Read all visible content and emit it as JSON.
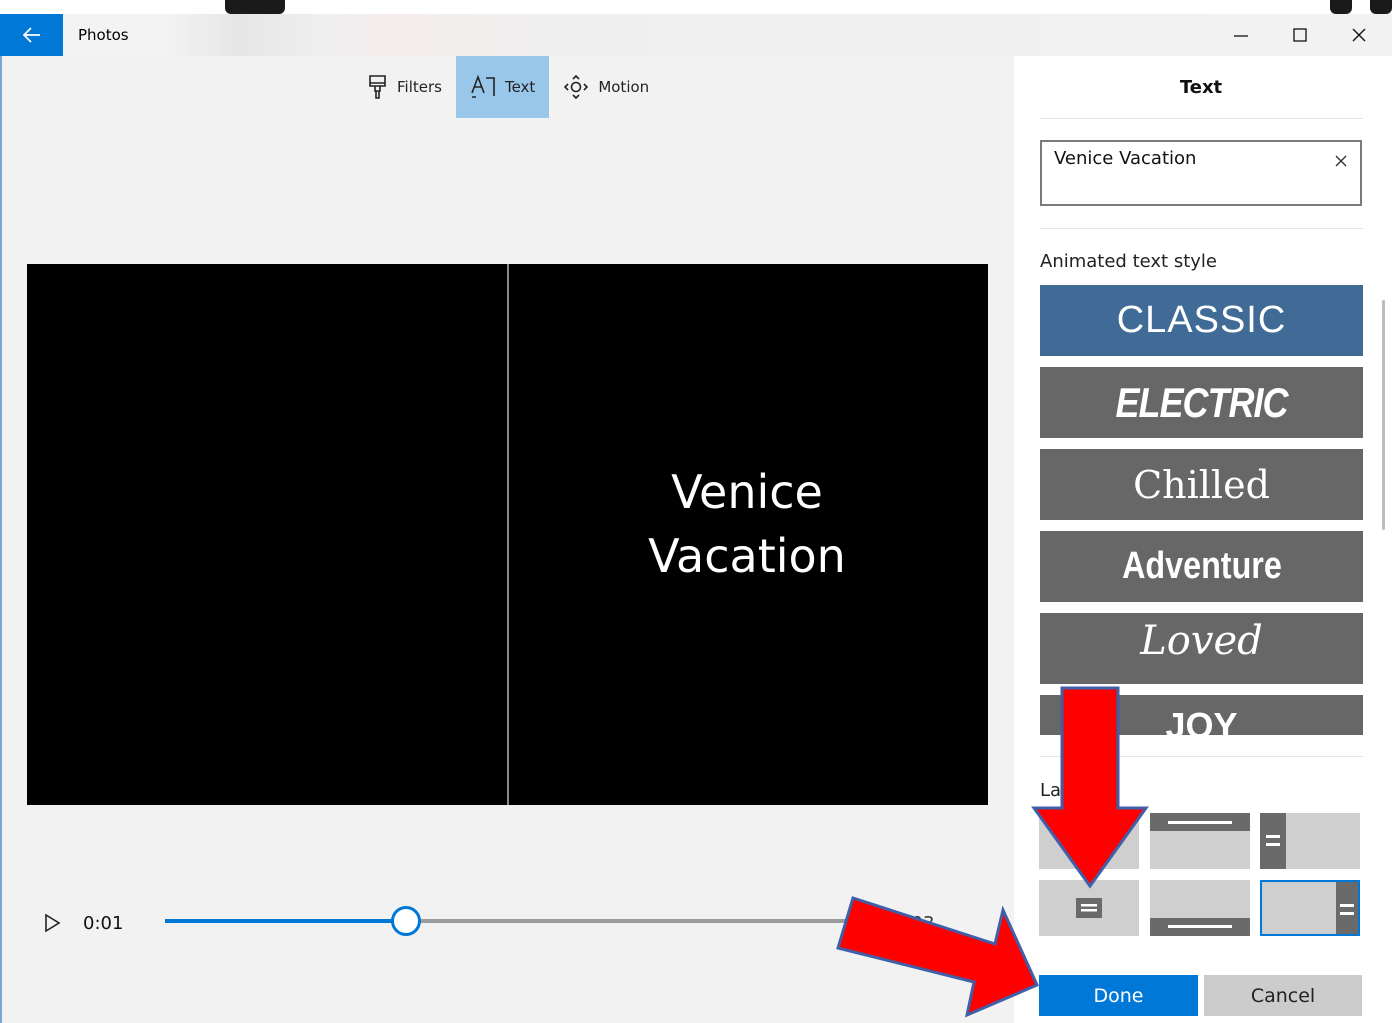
{
  "window": {
    "title": "Photos",
    "back_icon": "back-arrow-icon",
    "controls": [
      "minimize-icon",
      "maximize-icon",
      "close-icon"
    ],
    "accent": "#0078d7"
  },
  "toolbar": {
    "filters_label": "Filters",
    "text_label": "Text",
    "motion_label": "Motion",
    "active": "Text"
  },
  "preview": {
    "line1": "Venice",
    "line2": "Vacation"
  },
  "playback": {
    "current_time": "0:01",
    "end_time": "0:03",
    "progress": 0.35
  },
  "panel": {
    "title": "Text",
    "input_value": "Venice Vacation",
    "animated_label": "Animated text style",
    "styles": [
      "CLASSIC",
      "ELECTRIC",
      "Chilled",
      "Adventure",
      "Loved",
      "JOY"
    ],
    "selected_style": "CLASSIC",
    "selected_color": "#3f6b96",
    "layout_label": "Layout",
    "selected_layout": 5,
    "done_label": "Done",
    "cancel_label": "Cancel"
  },
  "annotation": {
    "arrow_color": "#ff0000",
    "arrow_outline": "#3f5fa8"
  }
}
